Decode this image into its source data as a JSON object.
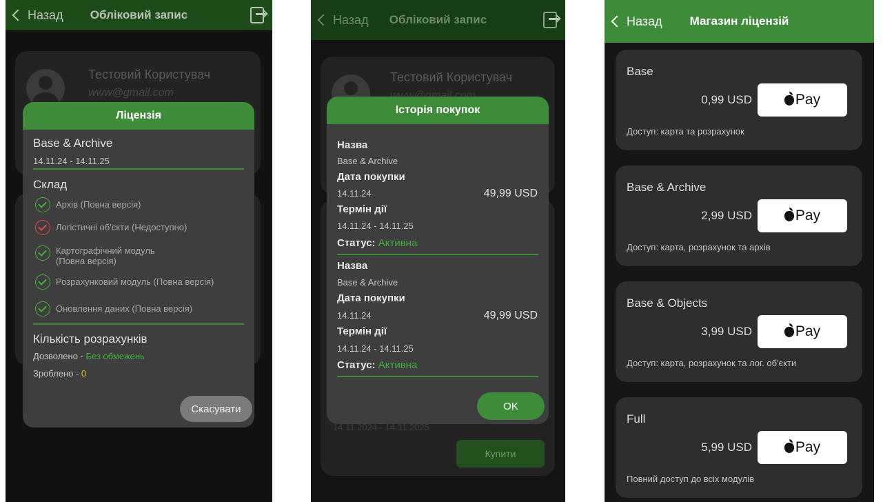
{
  "colors": {
    "accent": "#3e8b39",
    "status_active": "#45b03d",
    "warning": "#e8c300",
    "unavailable": "#e24646"
  },
  "phone1": {
    "header": {
      "back_label": "Назад",
      "title": "Обліковий запис",
      "logout_icon": "logout-icon"
    },
    "profile": {
      "name": "Тестовий Користувач",
      "email": "www@gmail.com"
    },
    "license_modal": {
      "title": "Ліцензія",
      "license_name": "Base & Archive",
      "license_period": "14.11.24 - 14.11.25",
      "components_title": "Склад",
      "features": [
        {
          "label": "Архів (Повна версія)",
          "status": "available"
        },
        {
          "label": "Логістичні об'єкти (Недоступно)",
          "status": "unavailable"
        },
        {
          "label": "Картографічний модуль",
          "label2": "(Повна версія)",
          "status": "available"
        },
        {
          "label": "Розрахунковий модуль (Повна версія)",
          "status": "available"
        },
        {
          "label": "Оновлення даних (Повна версія)",
          "status": "available"
        }
      ],
      "calc_title": "Кількість розрахунків",
      "allowed_label": "Дозволено - ",
      "allowed_value": "Без обмежень",
      "done_label": "Зроблено - ",
      "done_value": "0",
      "cancel_label": "Скасувати"
    }
  },
  "phone2": {
    "header": {
      "back_label": "Назад",
      "title": "Обліковий запис",
      "logout_icon": "logout-icon"
    },
    "profile": {
      "name": "Тестовий Користувач",
      "email": "www@gmail.com"
    },
    "history_modal": {
      "title": "Історія покупок",
      "name_label": "Назва",
      "date_label": "Дата покупки",
      "term_label": "Термін дії",
      "status_label": "Статус:",
      "purchases": [
        {
          "name": "Base & Archive",
          "date": "14.11.24",
          "price": "49,99 USD",
          "term": "14.11.24 - 14.11.25",
          "status": "Активна"
        },
        {
          "name": "Base & Archive",
          "date": "14.11.24",
          "price": "49,99 USD",
          "term": "14.11.24 - 14.11.25",
          "status": "Активна"
        }
      ],
      "ok_label": "OK"
    },
    "behind_period": "14.11.2024 - 14.11.2025",
    "buy_label": "Купити"
  },
  "phone3": {
    "header": {
      "back_label": "Назад",
      "title": "Магазин ліцензій"
    },
    "pay_label": "Pay",
    "products": [
      {
        "name": "Base",
        "price": "0,99 USD",
        "desc": "Доступ: карта та розрахунок"
      },
      {
        "name": "Base & Archive",
        "price": "2,99 USD",
        "desc": "Доступ: карта, розрахунок та архів"
      },
      {
        "name": "Base & Objects",
        "price": "3,99 USD",
        "desc": "Доступ: карта, розрахунок та лог. об'єкти"
      },
      {
        "name": "Full",
        "price": "5,99 USD",
        "desc": "Повний доступ до всіх модулів"
      }
    ]
  }
}
